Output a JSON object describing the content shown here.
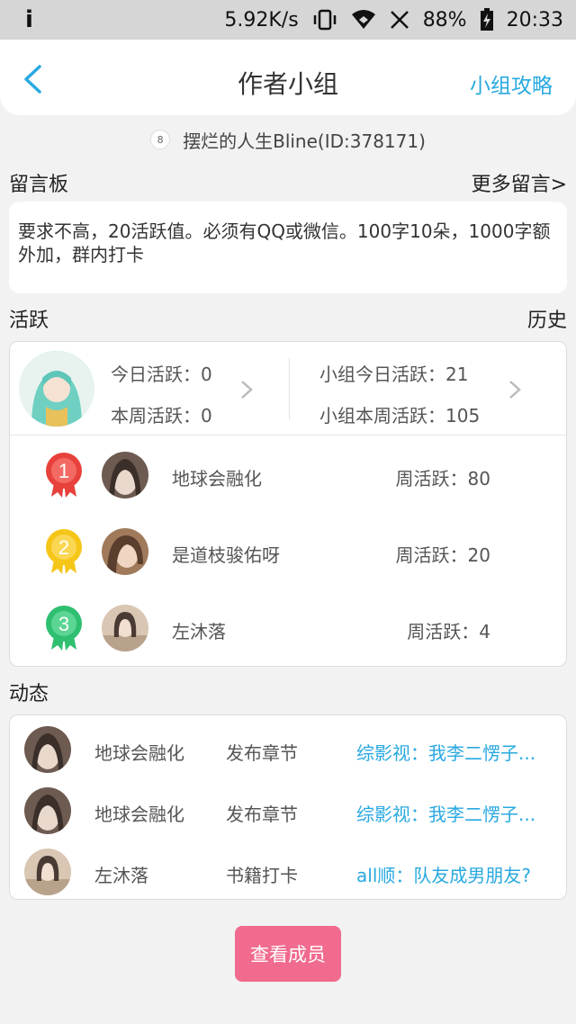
{
  "status_bar": {
    "left_icon": "info-icon",
    "left_glyph": "i",
    "speed": "5.92K/s",
    "battery": "88%",
    "time": "20:33"
  },
  "header": {
    "back_icon": "chevron-left-icon",
    "title": "作者小组",
    "guide_link": "小组攻略"
  },
  "author": {
    "icon_text": "8",
    "text": "摆烂的人生Bline(ID:378171)"
  },
  "message_board": {
    "title": "留言板",
    "more": "更多留言>",
    "content": "要求不高，20活跃值。必须有QQ或微信。100字10朵，1000字额外加，群内打卡"
  },
  "activity": {
    "title": "活跃",
    "history": "历史",
    "my_today": "今日活跃：0",
    "my_week": "本周活跃：0",
    "group_today": "小组今日活跃：21",
    "group_week": "小组本周活跃：105",
    "ranks": [
      {
        "rank": "1",
        "name": "地球会融化",
        "score": "周活跃：80",
        "medal_color": "#e8413c"
      },
      {
        "rank": "2",
        "name": "是道枝骏佑呀",
        "score": "周活跃：20",
        "medal_color": "#f5c518"
      },
      {
        "rank": "3",
        "name": "左沐落",
        "score": "周活跃：4",
        "medal_color": "#2fbf71"
      }
    ]
  },
  "feed": {
    "title": "动态",
    "items": [
      {
        "user": "地球会融化",
        "action": "发布章节",
        "link": "综影视：我李二愣子..."
      },
      {
        "user": "地球会融化",
        "action": "发布章节",
        "link": "综影视：我李二愣子..."
      },
      {
        "user": "左沐落",
        "action": "书籍打卡",
        "link": "all顺：队友成男朋友?"
      }
    ]
  },
  "buttons": {
    "view_members": "查看成员"
  },
  "colors": {
    "accent_blue": "#29a9e0",
    "button_pink": "#f06b8e"
  }
}
